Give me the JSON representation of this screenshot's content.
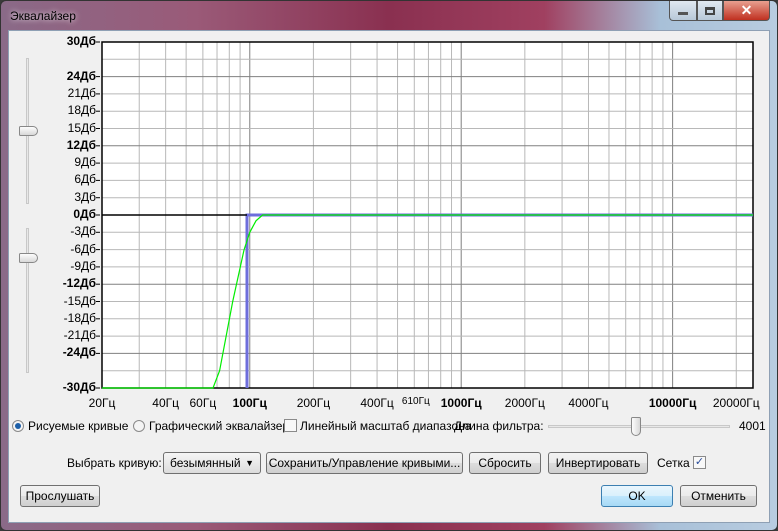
{
  "window": {
    "title": "Эквалайзер",
    "minimize": "minimize",
    "maximize": "maximize",
    "close": "close"
  },
  "y_axis_labels": [
    {
      "db": 30,
      "label": "30Дб",
      "bold": true
    },
    {
      "db": 24,
      "label": "24Дб",
      "bold": true
    },
    {
      "db": 21,
      "label": "21Дб"
    },
    {
      "db": 18,
      "label": "18Дб"
    },
    {
      "db": 15,
      "label": "15Дб"
    },
    {
      "db": 12,
      "label": "12Дб",
      "bold": true
    },
    {
      "db": 9,
      "label": "9Дб"
    },
    {
      "db": 6,
      "label": "6Дб"
    },
    {
      "db": 3,
      "label": "3Дб"
    },
    {
      "db": 0,
      "label": "0Дб",
      "bold": true
    },
    {
      "db": -3,
      "label": "-3Дб"
    },
    {
      "db": -6,
      "label": "-6Дб"
    },
    {
      "db": -9,
      "label": "-9Дб"
    },
    {
      "db": -12,
      "label": "-12Дб",
      "bold": true
    },
    {
      "db": -15,
      "label": "-15Дб"
    },
    {
      "db": -18,
      "label": "-18Дб"
    },
    {
      "db": -21,
      "label": "-21Дб"
    },
    {
      "db": -24,
      "label": "-24Дб",
      "bold": true
    },
    {
      "db": -30,
      "label": "-30Дб",
      "bold": true
    }
  ],
  "x_axis_labels": [
    {
      "hz": 20,
      "label": "20Гц"
    },
    {
      "hz": 40,
      "label": "40Гц"
    },
    {
      "hz": 60,
      "label": "60Гц"
    },
    {
      "hz": 100,
      "label": "100Гц",
      "bold": true
    },
    {
      "hz": 200,
      "label": "200Гц"
    },
    {
      "hz": 400,
      "label": "400Гц"
    },
    {
      "hz": 610,
      "label": "610Гц",
      "small": true
    },
    {
      "hz": 1000,
      "label": "1000Гц",
      "bold": true
    },
    {
      "hz": 2000,
      "label": "2000Гц"
    },
    {
      "hz": 4000,
      "label": "4000Гц"
    },
    {
      "hz": 10000,
      "label": "10000Гц",
      "bold": true
    },
    {
      "hz": 20000,
      "label": "20000Гц"
    }
  ],
  "chart_data": {
    "type": "line",
    "xscale": "log",
    "xlim": [
      20,
      24000
    ],
    "ylim": [
      -30,
      30
    ],
    "grid": true,
    "series": [
      {
        "name": "drawn-curve",
        "color": "#6e6edc",
        "points": [
          [
            97,
            -30
          ],
          [
            97,
            0
          ],
          [
            24000,
            0
          ]
        ]
      },
      {
        "name": "response",
        "color": "#00ee00",
        "points": [
          [
            20,
            -30
          ],
          [
            67,
            -30
          ],
          [
            72,
            -27
          ],
          [
            83,
            -15
          ],
          [
            94,
            -6
          ],
          [
            100,
            -3
          ],
          [
            107,
            -1
          ],
          [
            115,
            0
          ],
          [
            24000,
            0
          ]
        ]
      },
      {
        "name": "zero-line",
        "color": "#000000",
        "points": [
          [
            20,
            0
          ],
          [
            97,
            0
          ]
        ]
      }
    ]
  },
  "sliders": {
    "gain_upper_fraction": 0.5,
    "gain_lower_fraction": 0.2
  },
  "controls": {
    "radio_draw": "Рисуемые кривые",
    "radio_draw_selected": true,
    "radio_graphic": "Графический эквалайзер",
    "radio_graphic_selected": false,
    "linear_scale": "Линейный масштаб диапазона",
    "linear_scale_checked": false,
    "filter_length_label": "Длина фильтра:",
    "filter_length_value": "4001",
    "filter_length_fraction": 0.48,
    "select_curve_label": "Выбрать кривую:",
    "curve_value": "безымянный",
    "save_manage": "Сохранить/Управление кривыми...",
    "reset": "Сбросить",
    "invert": "Инвертировать",
    "grid_label": "Сетка",
    "grid_checked": true,
    "preview": "Прослушать",
    "ok": "OK",
    "cancel": "Отменить"
  },
  "colors": {
    "curve": "#6e6edc",
    "response": "#00ee00",
    "grid": "#b0b0b0"
  }
}
